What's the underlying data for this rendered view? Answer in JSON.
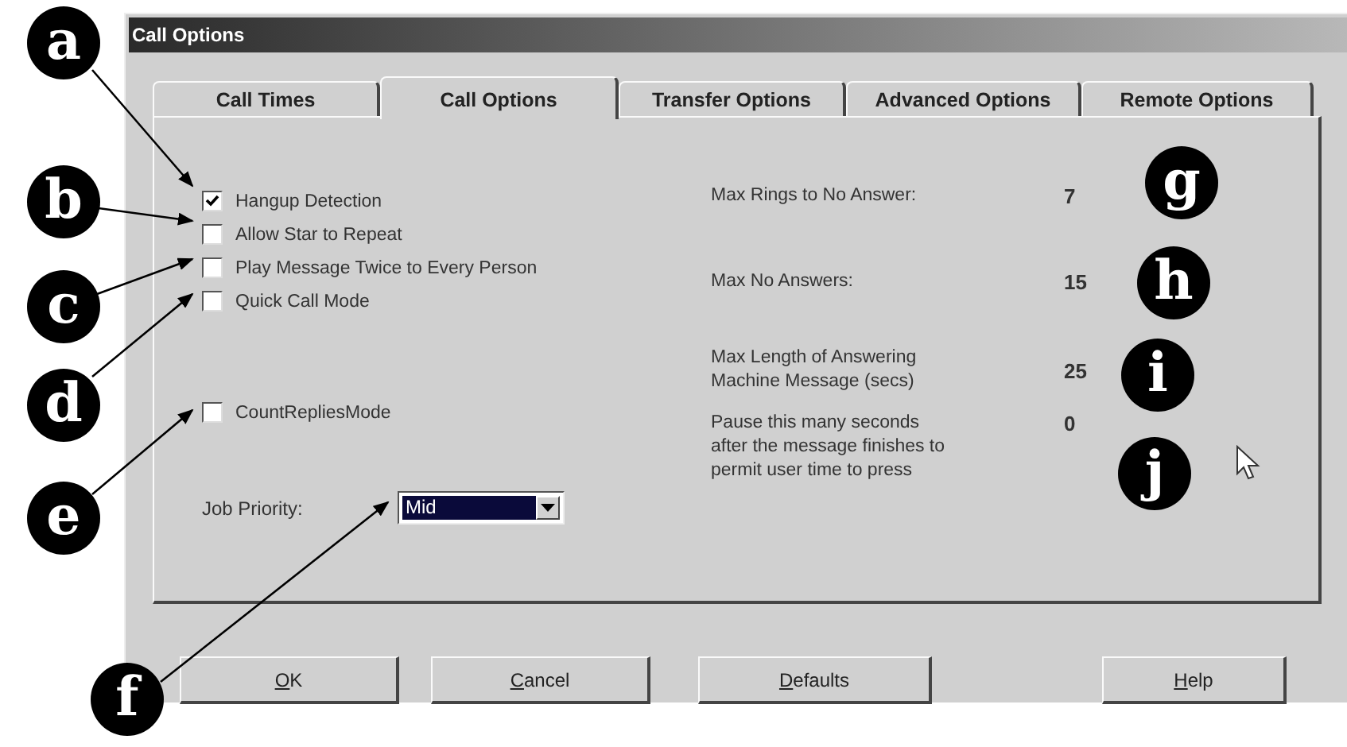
{
  "window": {
    "title": "Call Options"
  },
  "tabs": [
    {
      "label": "Call Times",
      "selected": false
    },
    {
      "label": "Call Options",
      "selected": true
    },
    {
      "label": "Transfer Options",
      "selected": false
    },
    {
      "label": "Advanced Options",
      "selected": false
    },
    {
      "label": "Remote Options",
      "selected": false
    }
  ],
  "options": [
    {
      "label": "Hangup Detection",
      "checked": true
    },
    {
      "label": "Allow Star to Repeat",
      "checked": false
    },
    {
      "label": "Play Message Twice to Every Person",
      "checked": false
    },
    {
      "label": "Quick Call Mode",
      "checked": false
    }
  ],
  "extra_options": [
    {
      "label": "CountRepliesMode",
      "checked": false
    }
  ],
  "job_priority": {
    "label": "Job Priority:",
    "value": "Mid"
  },
  "settings": [
    {
      "lines": [
        "Max Rings to No Answer:"
      ],
      "value": "7"
    },
    {
      "lines": [
        "Max No Answers:"
      ],
      "value": "15"
    },
    {
      "lines": [
        "Max Length of Answering",
        "Machine Message (secs)"
      ],
      "value": "25"
    },
    {
      "lines": [
        "Pause this many seconds",
        "after the message finishes to",
        "permit user time to press"
      ],
      "value": "0"
    }
  ],
  "buttons": [
    {
      "label": "OK",
      "mnemonic": true
    },
    {
      "label": "Cancel",
      "mnemonic": true
    },
    {
      "label": "Defaults",
      "mnemonic": true
    },
    {
      "label": "Help",
      "mnemonic": true
    }
  ],
  "callouts": [
    {
      "label": "a"
    },
    {
      "label": "b"
    },
    {
      "label": "c"
    },
    {
      "label": "d"
    },
    {
      "label": "e"
    },
    {
      "label": "f"
    },
    {
      "label": "g"
    },
    {
      "label": "h"
    },
    {
      "label": "i"
    },
    {
      "label": "j"
    }
  ]
}
